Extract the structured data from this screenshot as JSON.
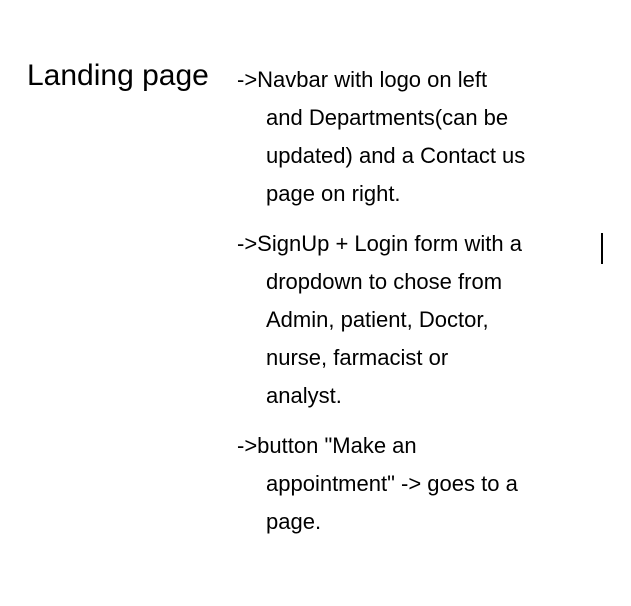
{
  "document": {
    "heading": "Landing page",
    "notes": [
      {
        "lines": [
          "->Navbar with logo on left",
          "and Departments(can be",
          "updated) and a Contact us",
          "page on right."
        ]
      },
      {
        "lines": [
          "->SignUp + Login form with a",
          "dropdown to chose from",
          "Admin, patient, Doctor,",
          "nurse, farmacist or",
          "analyst."
        ]
      },
      {
        "lines": [
          "->button \"Make an",
          "appointment\" -> goes to a",
          "page."
        ]
      }
    ]
  }
}
